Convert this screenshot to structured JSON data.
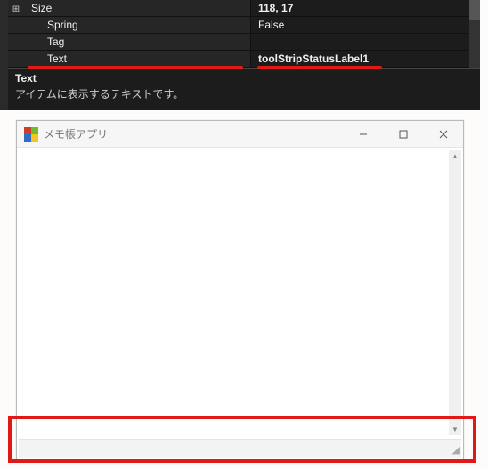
{
  "propgrid": {
    "rows": [
      {
        "name": "Size",
        "value": "118, 17",
        "bold": true,
        "expand": true
      },
      {
        "name": "Spring",
        "value": "False",
        "bold": false,
        "expand": false
      },
      {
        "name": "Tag",
        "value": "",
        "bold": false,
        "expand": false
      },
      {
        "name": "Text",
        "value": "toolStripStatusLabel1",
        "bold": true,
        "expand": false
      }
    ],
    "desc_title": "Text",
    "desc_text": "アイテムに表示するテキストです。"
  },
  "window": {
    "title": "メモ帳アプリ",
    "text_value": "",
    "status_label": ""
  }
}
